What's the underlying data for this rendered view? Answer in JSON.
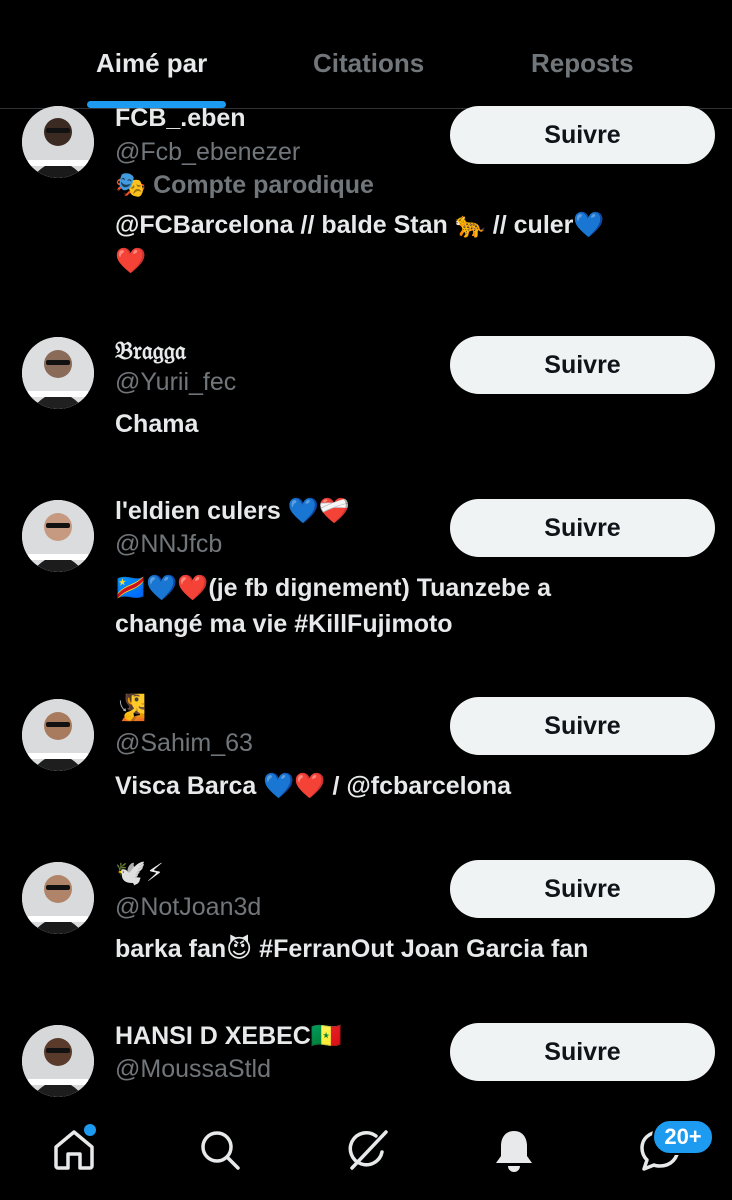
{
  "tabs": [
    {
      "label": "Aimé par",
      "active": true
    },
    {
      "label": "Citations",
      "active": false
    },
    {
      "label": "Reposts",
      "active": false
    }
  ],
  "users": [
    {
      "name": "FCB_.eben",
      "handle": "@Fcb_ebenezer",
      "badge": "🎭 Compte parodique",
      "bio_lines": [
        "@FCBarcelona // balde Stan 🐆 // culer💙",
        "❤️"
      ],
      "follow_label": "Suivre"
    },
    {
      "name": "𝔅𝔯𝔞𝔤𝔤𝔞",
      "handle": "@Yurii_fec",
      "bio_lines": [
        "Chama"
      ],
      "follow_label": "Suivre"
    },
    {
      "name": "l'eldien culers 💙❤️‍🩹",
      "handle": "@NNJfcb",
      "bio_lines": [
        "🇨🇩💙❤️(je fb dignement) Tuanzebe a",
        "changé ma vie #KillFujimoto"
      ],
      "follow_label": "Suivre"
    },
    {
      "name": "🧏",
      "handle": "@Sahim_63",
      "bio_lines": [
        "Visca Barca 💙❤️ / @fcbarcelona"
      ],
      "follow_label": "Suivre"
    },
    {
      "name": "🕊️⚡",
      "handle": "@NotJoan3d",
      "bio_lines": [
        "barka fan😈 #FerranOut Joan Garcia fan"
      ],
      "follow_label": "Suivre"
    },
    {
      "name": "HANSI D XEBEC🇸🇳",
      "handle": "@MoussaStld",
      "bio_lines": [],
      "follow_label": "Suivre"
    }
  ],
  "nav": {
    "items": [
      "home-icon",
      "search-icon",
      "grok-icon",
      "notifications-icon",
      "messages-icon"
    ],
    "messages_count": "20+",
    "accent": "#1d9bf0"
  }
}
